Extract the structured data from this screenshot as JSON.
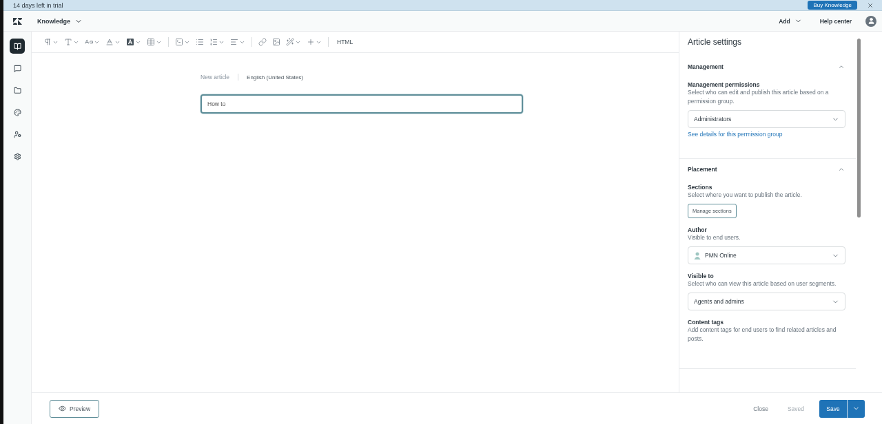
{
  "banner": {
    "text": "14 days left in trial",
    "button": "Buy Knowledge"
  },
  "header": {
    "product": "Knowledge",
    "add": "Add",
    "help_center": "Help center"
  },
  "nav_items": [
    {
      "selected": true
    },
    {
      "selected": false
    },
    {
      "selected": false
    },
    {
      "selected": false
    },
    {
      "selected": false
    },
    {
      "selected": false
    }
  ],
  "toolbar": {
    "html": "HTML"
  },
  "editor": {
    "status": "New article",
    "language": "English (United States)",
    "title_value": "How to "
  },
  "settings": {
    "title": "Article settings",
    "sections": [
      {
        "title": "Management",
        "expanded": true,
        "fields": [
          {
            "label": "Management permissions",
            "description": "Select who can edit and publish this article based on a permission group.",
            "controls": [
              {
                "kind": "select",
                "text": "Administrators"
              },
              {
                "kind": "link",
                "text": "See details for this permission group"
              }
            ]
          }
        ]
      },
      {
        "title": "Placement",
        "expanded": true,
        "fields": [
          {
            "label": "Sections",
            "description": "Select where you want to publish the article.",
            "controls": [
              {
                "kind": "button",
                "text": "Manage sections"
              }
            ]
          },
          {
            "label": "Author",
            "description": "Visible to end users.",
            "controls": [
              {
                "kind": "user-select",
                "text": "PMN Online"
              }
            ]
          },
          {
            "label": "Visible to",
            "description": "Select who can view this article based on user segments.",
            "controls": [
              {
                "kind": "select",
                "text": "Agents and admins"
              }
            ]
          },
          {
            "label": "Content tags",
            "description": "Add content tags for end users to find related articles and posts."
          }
        ]
      }
    ]
  },
  "footer": {
    "preview": "Preview",
    "close": "Close",
    "saved": "Saved",
    "save": "Save"
  }
}
